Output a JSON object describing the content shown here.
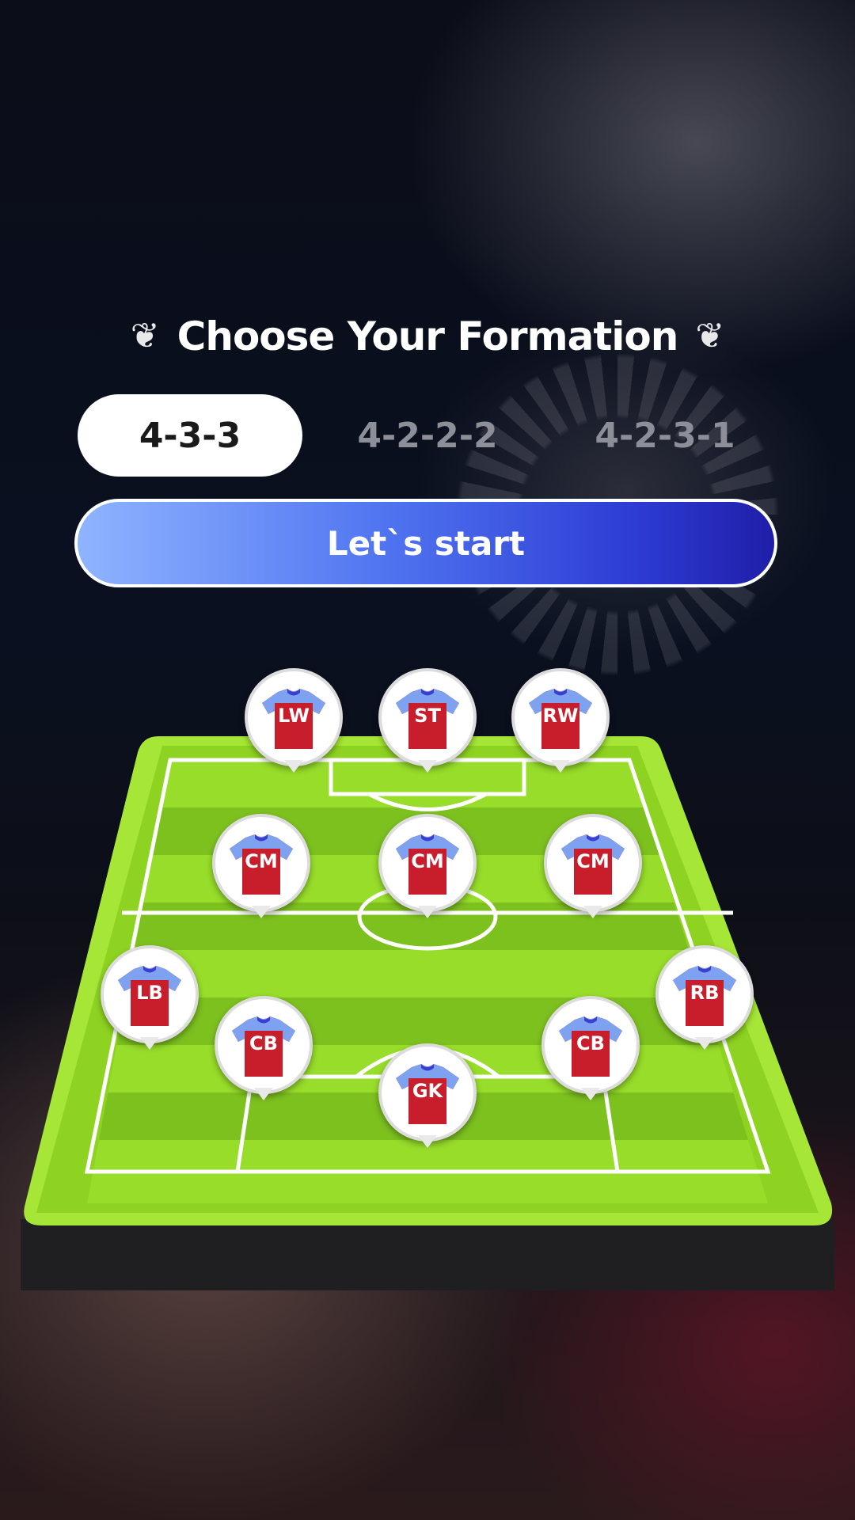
{
  "header": {
    "title": "Choose Your Formation"
  },
  "formations": {
    "tabs": [
      {
        "label": "4-3-3",
        "selected": true
      },
      {
        "label": "4-2-2-2",
        "selected": false
      },
      {
        "label": "4-2-3-1",
        "selected": false
      }
    ]
  },
  "actions": {
    "start_label": "Let`s start"
  },
  "pitch": {
    "positions": [
      "LW",
      "ST",
      "RW",
      "CM",
      "CM",
      "CM",
      "LB",
      "CB",
      "CB",
      "RB",
      "GK"
    ]
  },
  "colors": {
    "accent_blue": "#2d3cd4",
    "pitch_green": "#8ed321",
    "jersey_body": "#c81e2b",
    "jersey_sleeves": "#7ea2f0"
  },
  "icons": {
    "title_left": "laurel-icon",
    "title_right": "laurel-icon",
    "player": "jersey-icon"
  }
}
